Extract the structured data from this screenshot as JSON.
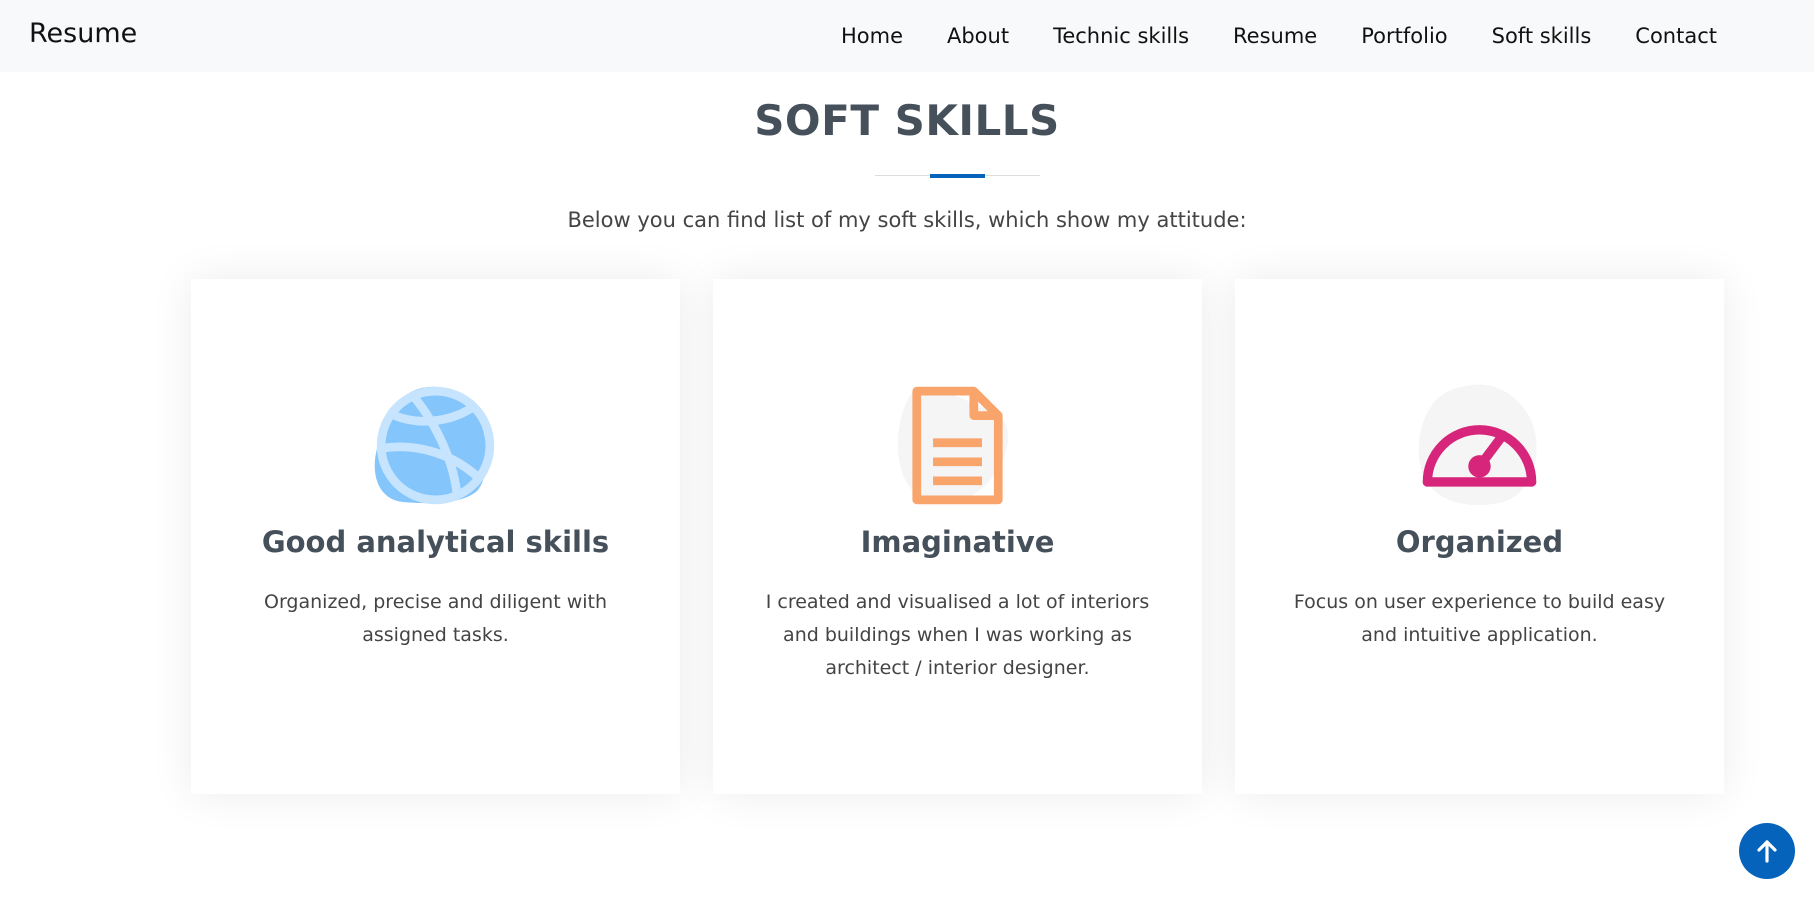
{
  "brand": "Resume",
  "nav": {
    "items": [
      "Home",
      "About",
      "Technic skills",
      "Resume",
      "Portfolio",
      "Soft skills",
      "Contact"
    ]
  },
  "section": {
    "title": "SOFT SKILLS",
    "subtitle": "Below you can find list of my soft skills, which show my attitude:"
  },
  "cards": [
    {
      "title": "Good analytical skills",
      "description": "Organized, precise and diligent with assigned tasks.",
      "icon": "dribbble-icon",
      "blob_color": "#84c5fb",
      "icon_color": "#c6e4fd"
    },
    {
      "title": "Imaginative",
      "description": "I created and visualised a lot of interiors and buildings when I was working as architect / interior designer.",
      "icon": "file-text-icon",
      "blob_color": "#f5f5f5",
      "icon_color": "#f8a46a"
    },
    {
      "title": "Organized",
      "description": "Focus on user experience to build easy and intuitive application.",
      "icon": "speedometer-icon",
      "blob_color": "#f5f5f5",
      "icon_color": "#d6257b"
    }
  ],
  "colors": {
    "accent": "#0563bb",
    "heading": "#45505b",
    "navbar_bg": "#f8f9fa"
  },
  "back_to_top": {
    "icon": "arrow-up-icon"
  }
}
